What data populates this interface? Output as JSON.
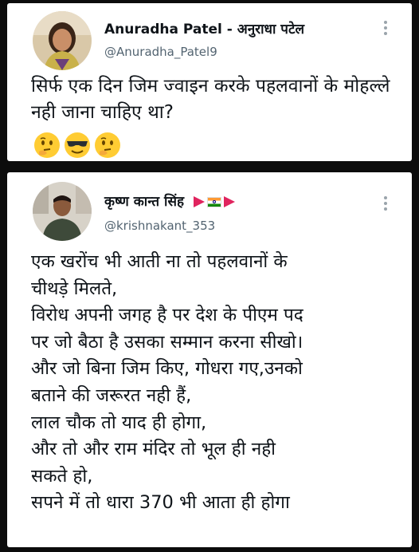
{
  "tweet1": {
    "display_name": "Anuradha Patel - अनुराधा पटेल",
    "handle": "@Anuradha_Patel9",
    "text": "सिर्फ एक दिन जिम ज्वाइन करके पहलवानों के मोहल्ले नही जाना चाहिए था?",
    "emojis": [
      "thinking-face",
      "smiling-face-with-sunglasses",
      "thinking-face"
    ],
    "more_icon": "more-icon"
  },
  "tweet2": {
    "display_name": "कृष्ण कान्त सिंह",
    "flags": [
      "triangular-flag",
      "india-flag",
      "triangular-flag"
    ],
    "handle": "@krishnakant_353",
    "text": "एक खरोंच भी आती ना तो पहलवानों के\nचीथड़े मिलते,\nविरोध अपनी जगह है पर देश के पीएम पद\nपर जो बैठा है उसका सम्मान करना सीखो।\nऔर जो बिना जिम किए, गोधरा गए,उनको\nबताने की जरूरत नही हैं,\nलाल चौक तो याद ही होगा,\nऔर तो और राम मंदिर तो भूल ही नही\nसकते हो,\nसपने में तो धारा 370 भी आता ही होगा",
    "more_icon": "more-icon"
  }
}
